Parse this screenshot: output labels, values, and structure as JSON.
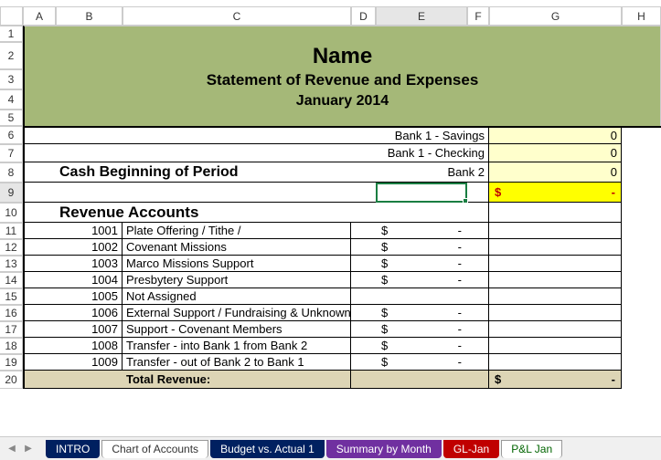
{
  "cols": [
    "A",
    "B",
    "C",
    "D",
    "E",
    "F",
    "G",
    "H"
  ],
  "header": {
    "name": "Name",
    "statement": "Statement of Revenue and Expenses",
    "period": "January  2014"
  },
  "banks": [
    {
      "label": "Bank 1 - Savings",
      "value": "0"
    },
    {
      "label": "Bank 1 - Checking",
      "value": "0"
    },
    {
      "label": "Bank 2",
      "value": "0"
    }
  ],
  "cash_label": "Cash Beginning of Period",
  "total_cash": {
    "symbol": "$",
    "value": "-"
  },
  "rev_header": "Revenue Accounts",
  "revenues": [
    {
      "code": "1001",
      "desc": "Plate Offering / Tithe /",
      "amt": "-"
    },
    {
      "code": "1002",
      "desc": "Covenant Missions",
      "amt": "-"
    },
    {
      "code": "1003",
      "desc": "Marco Missions Support",
      "amt": "-"
    },
    {
      "code": "1004",
      "desc": "Presbytery Support",
      "amt": "-"
    },
    {
      "code": "1005",
      "desc": "Not Assigned",
      "amt": ""
    },
    {
      "code": "1006",
      "desc": "External Support / Fundraising & Unknown",
      "amt": "-"
    },
    {
      "code": "1007",
      "desc": "Support - Covenant Members",
      "amt": "-"
    },
    {
      "code": "1008",
      "desc": "Transfer - into Bank 1 from Bank 2",
      "amt": "-"
    },
    {
      "code": "1009",
      "desc": "Transfer - out of Bank 2 to Bank 1",
      "amt": "-"
    }
  ],
  "total_rev_label": "Total Revenue:",
  "total_rev": {
    "symbol": "$",
    "value": "-"
  },
  "currency": "$",
  "tabs": {
    "intro": "INTRO",
    "coa": "Chart of Accounts",
    "budget": "Budget vs. Actual 1",
    "summary": "Summary by Month",
    "gl": "GL-Jan",
    "pnl": "P&L Jan"
  },
  "rownums": [
    "1",
    "2",
    "3",
    "4",
    "5",
    "6",
    "7",
    "8",
    "9",
    "10",
    "11",
    "12",
    "13",
    "14",
    "15",
    "16",
    "17",
    "18",
    "19",
    "20"
  ]
}
